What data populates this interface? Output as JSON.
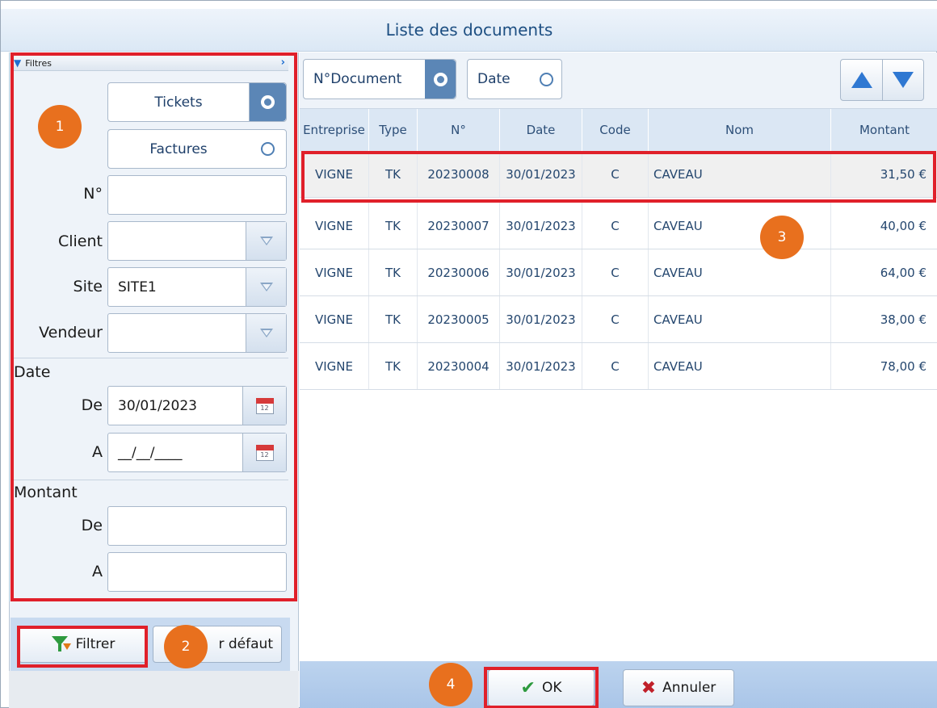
{
  "window": {
    "title": "Liste des documents"
  },
  "filters": {
    "header": "Filtres",
    "doc_types": [
      {
        "label": "Tickets",
        "selected": true
      },
      {
        "label": "Factures",
        "selected": false
      }
    ],
    "number_label": "N°",
    "number_value": "",
    "client_label": "Client",
    "client_value": "",
    "site_label": "Site",
    "site_value": "SITE1",
    "vendor_label": "Vendeur",
    "vendor_value": "",
    "date_section": "Date",
    "date_from_label": "De",
    "date_from_value": "30/01/2023",
    "date_to_label": "A",
    "date_to_value": "__/__/____",
    "amount_section": "Montant",
    "amount_from_label": "De",
    "amount_from_value": "",
    "amount_to_label": "A",
    "amount_to_value": "",
    "filter_button": "Filtrer",
    "default_button": "r défaut",
    "calendar_day": "12"
  },
  "sort": {
    "options": [
      {
        "label": "N°Document",
        "selected": true
      },
      {
        "label": "Date",
        "selected": false
      }
    ]
  },
  "table": {
    "columns": [
      "Entreprise",
      "Type",
      "N°",
      "Date",
      "Code",
      "Nom",
      "Montant"
    ],
    "rows": [
      {
        "entreprise": "VIGNE",
        "type": "TK",
        "numero": "20230008",
        "date": "30/01/2023",
        "code": "C",
        "nom": "CAVEAU",
        "montant": "31,50 €"
      },
      {
        "entreprise": "VIGNE",
        "type": "TK",
        "numero": "20230007",
        "date": "30/01/2023",
        "code": "C",
        "nom": "CAVEAU",
        "montant": "40,00 €"
      },
      {
        "entreprise": "VIGNE",
        "type": "TK",
        "numero": "20230006",
        "date": "30/01/2023",
        "code": "C",
        "nom": "CAVEAU",
        "montant": "64,00 €"
      },
      {
        "entreprise": "VIGNE",
        "type": "TK",
        "numero": "20230005",
        "date": "30/01/2023",
        "code": "C",
        "nom": "CAVEAU",
        "montant": "38,00 €"
      },
      {
        "entreprise": "VIGNE",
        "type": "TK",
        "numero": "20230004",
        "date": "30/01/2023",
        "code": "C",
        "nom": "CAVEAU",
        "montant": "78,00 €"
      }
    ]
  },
  "footer": {
    "ok_label": "OK",
    "cancel_label": "Annuler"
  },
  "annotations": [
    "1",
    "2",
    "3",
    "4"
  ],
  "colors": {
    "accent": "#5b86b6",
    "highlight": "#e0202a",
    "badge": "#e8701e",
    "check": "#2e9a3f",
    "cancel": "#c0202a"
  }
}
